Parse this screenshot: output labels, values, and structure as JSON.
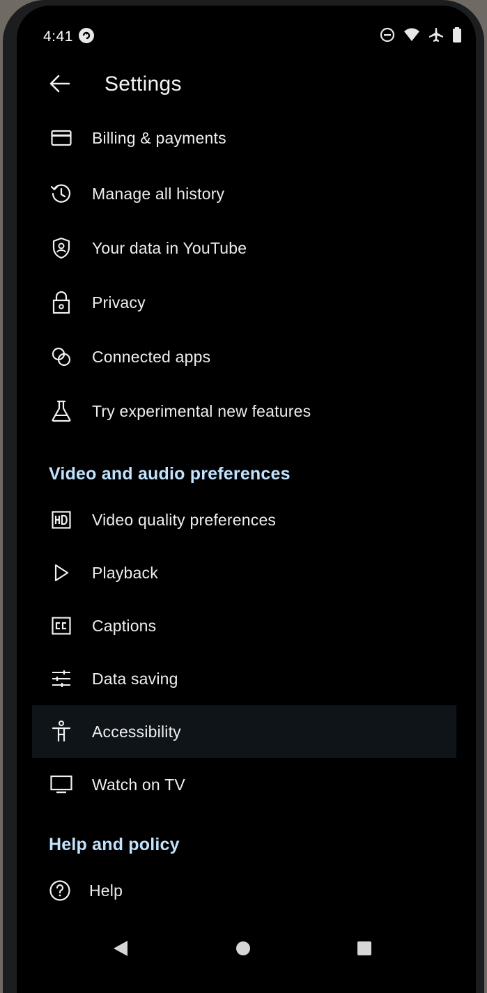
{
  "status_bar": {
    "time": "4:41",
    "icons": [
      "app-notification-icon",
      "do-not-disturb-icon",
      "wifi-icon",
      "airplane-mode-icon",
      "battery-icon"
    ]
  },
  "header": {
    "title": "Settings",
    "back_icon": "arrow-back-icon"
  },
  "account_items": [
    {
      "label": "Billing & payments",
      "icon": "credit-card-icon"
    },
    {
      "label": "Manage all history",
      "icon": "history-icon"
    },
    {
      "label": "Your data in YouTube",
      "icon": "shield-person-icon"
    },
    {
      "label": "Privacy",
      "icon": "lock-icon"
    },
    {
      "label": "Connected apps",
      "icon": "connected-circles-icon"
    },
    {
      "label": "Try experimental new features",
      "icon": "flask-icon"
    }
  ],
  "video_section": {
    "heading": "Video and audio preferences",
    "items": [
      {
        "label": "Video quality preferences",
        "icon": "hd-icon"
      },
      {
        "label": "Playback",
        "icon": "play-outline-icon"
      },
      {
        "label": "Captions",
        "icon": "cc-icon"
      },
      {
        "label": "Data saving",
        "icon": "sliders-icon"
      },
      {
        "label": "Accessibility",
        "icon": "accessibility-icon",
        "highlighted": true
      },
      {
        "label": "Watch on TV",
        "icon": "tv-icon"
      }
    ]
  },
  "help_section": {
    "heading": "Help and policy",
    "items": [
      {
        "label": "Help",
        "icon": "help-circle-icon"
      }
    ]
  },
  "nav_bar": {
    "icons": [
      "nav-back-icon",
      "nav-home-icon",
      "nav-recents-icon"
    ]
  },
  "colors": {
    "background": "#000000",
    "text": "#eeeeee",
    "section_heading": "#bfe4ff",
    "highlight_row": "#0f1418"
  }
}
